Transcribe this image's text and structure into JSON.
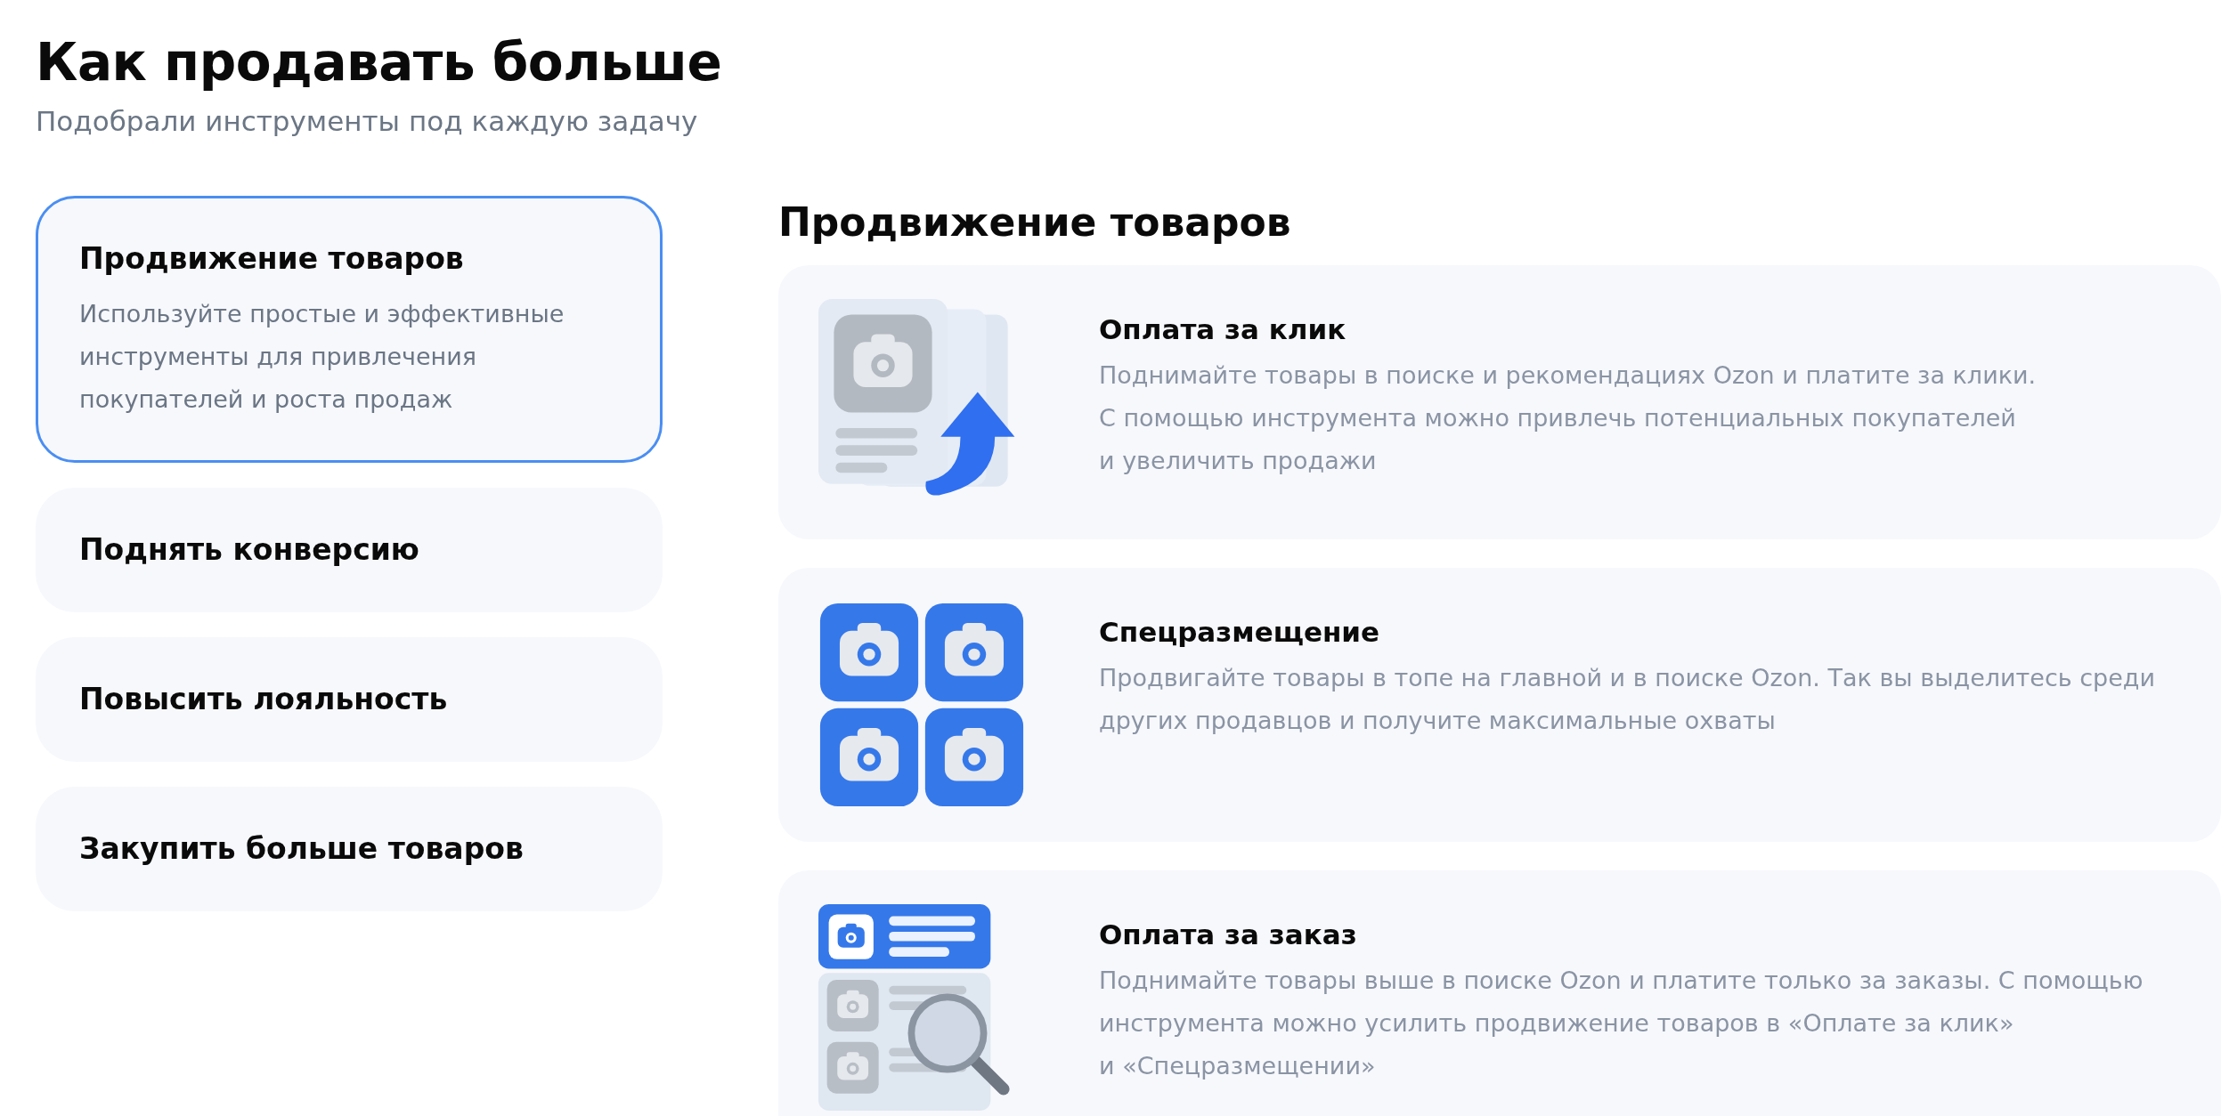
{
  "title": "Как продавать больше",
  "subtitle": "Подобрали инструменты под каждую задачу",
  "categories": [
    {
      "title": "Продвижение товаров",
      "selected": true,
      "description": [
        "Используйте простые и эффективные",
        "инструменты для привлечения",
        "покупателей и роста продаж"
      ]
    },
    {
      "title": "Поднять конверсию",
      "selected": false
    },
    {
      "title": "Повысить лояльность",
      "selected": false
    },
    {
      "title": "Закупить больше товаров",
      "selected": false
    }
  ],
  "section_title": "Продвижение товаров",
  "tools": [
    {
      "kind": "click",
      "title": "Оплата за клик",
      "description": [
        "Поднимайте товары в поиске и рекомендациях Ozon и платите за клики.",
        "С помощью инструмента можно привлечь потенциальных покупателей",
        "и увеличить продажи"
      ]
    },
    {
      "kind": "placement",
      "title": "Спецразмещение",
      "description": [
        "Продвигайте товары в топе на главной и в поиске Ozon. Так вы выделитесь среди",
        "других продавцов и получите максимальные охваты"
      ]
    },
    {
      "kind": "order",
      "title": "Оплата за заказ",
      "description": [
        "Поднимайте товары выше в поиске Ozon и платите только за заказы. С помощью",
        "инструмента можно усилить продвижение товаров в «Оплате за клик»",
        "и «Спецразмещении»"
      ]
    }
  ]
}
